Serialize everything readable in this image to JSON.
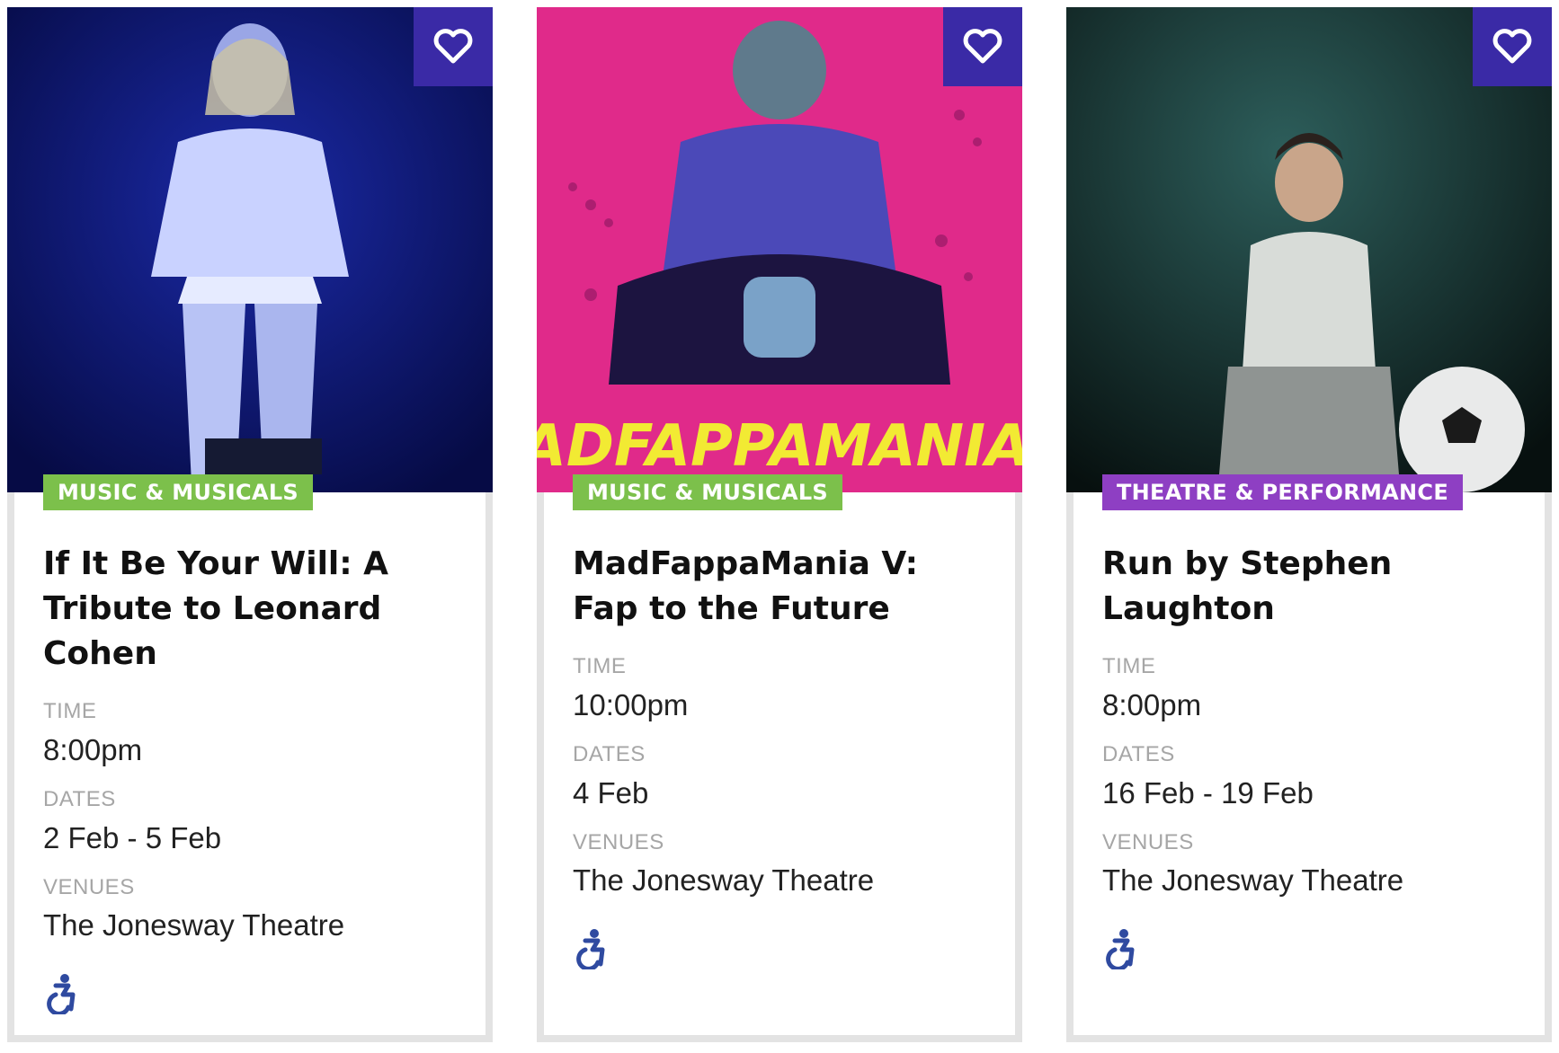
{
  "events": [
    {
      "category": "MUSIC & MUSICALS",
      "title": "If It Be Your Will: A Tribute to Leonard Cohen",
      "time_label": "TIME",
      "time": "8:00pm",
      "dates_label": "DATES",
      "dates": "2 Feb - 5 Feb",
      "venues_label": "VENUES",
      "venue": "The Jonesway Theatre",
      "category_color": "#7cc04b"
    },
    {
      "category": "MUSIC & MUSICALS",
      "title": "MadFappaMania V: Fap to the Future",
      "time_label": "TIME",
      "time": "10:00pm",
      "dates_label": "DATES",
      "dates": "4 Feb",
      "venues_label": "VENUES",
      "venue": "The Jonesway Theatre",
      "image_text": "MADFAPPAMANIA V",
      "category_color": "#7cc04b"
    },
    {
      "category": "THEATRE & PERFORMANCE",
      "title": "Run by Stephen Laughton",
      "time_label": "TIME",
      "time": "8:00pm",
      "dates_label": "DATES",
      "dates": "16 Feb - 19 Feb",
      "venues_label": "VENUES",
      "venue": "The Jonesway Theatre",
      "category_color": "#8e3fc3"
    }
  ],
  "icons": {
    "favorite": "heart-icon",
    "accessibility": "wheelchair-icon"
  },
  "colors": {
    "favorite_bg": "#3a2aa6",
    "accessibility_icon": "#2f4aa0",
    "card_border": "#e3e3e3"
  }
}
